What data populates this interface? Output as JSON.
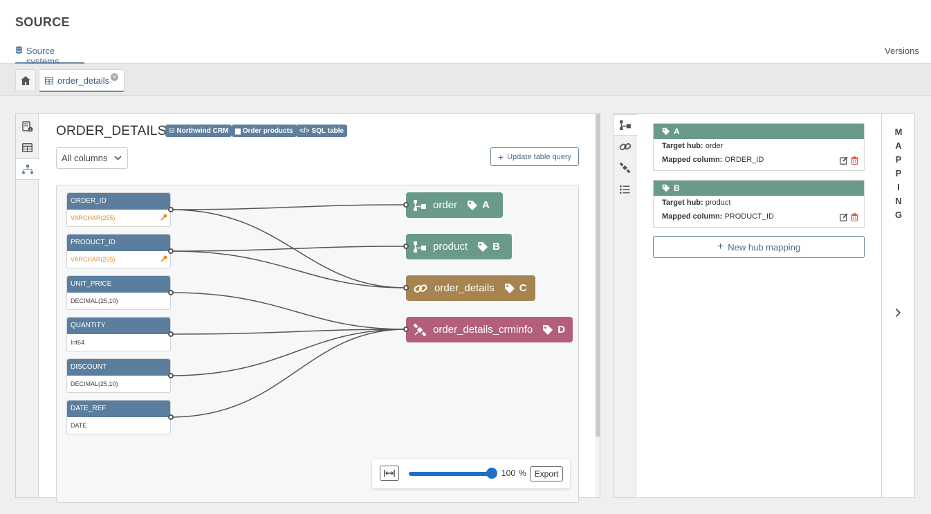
{
  "header": {
    "title": "SOURCE",
    "nav_tab": "Source systems",
    "versions": "Versions"
  },
  "tabs": {
    "open_tab": "order_details"
  },
  "table": {
    "title": "ORDER_DETAILS",
    "badges": [
      "Northwind CRM",
      "Order products",
      "SQL table"
    ],
    "filter_value": "All columns",
    "update_button": "Update table query"
  },
  "columns": [
    {
      "name": "ORDER_ID",
      "type": "VARCHAR(255)",
      "is_key": true
    },
    {
      "name": "PRODUCT_ID",
      "type": "VARCHAR(255)",
      "is_key": true
    },
    {
      "name": "UNIT_PRICE",
      "type": "DECIMAL(25,10)",
      "is_key": false
    },
    {
      "name": "QUANTITY",
      "type": "Int64",
      "is_key": false
    },
    {
      "name": "DISCOUNT",
      "type": "DECIMAL(25,10)",
      "is_key": false
    },
    {
      "name": "DATE_REF",
      "type": "DATE",
      "is_key": false
    }
  ],
  "targets": [
    {
      "name": "order",
      "letter": "A",
      "kind": "hub",
      "color": "#699a8c"
    },
    {
      "name": "product",
      "letter": "B",
      "kind": "hub",
      "color": "#699a8c"
    },
    {
      "name": "order_details",
      "letter": "C",
      "kind": "link",
      "color": "#a68450"
    },
    {
      "name": "order_details_crminfo",
      "letter": "D",
      "kind": "satellite",
      "color": "#b35f7c"
    }
  ],
  "zoom": {
    "value": "100",
    "unit": "%",
    "export_label": "Export"
  },
  "mappings": [
    {
      "letter": "A",
      "target_label": "Target hub:",
      "target_value": "order",
      "column_label": "Mapped column:",
      "column_value": "ORDER_ID"
    },
    {
      "letter": "B",
      "target_label": "Target hub:",
      "target_value": "product",
      "column_label": "Mapped column:",
      "column_value": "PRODUCT_ID"
    }
  ],
  "new_hub_button": "New hub mapping",
  "side_label": [
    "M",
    "A",
    "P",
    "P",
    "I",
    "N",
    "G"
  ]
}
